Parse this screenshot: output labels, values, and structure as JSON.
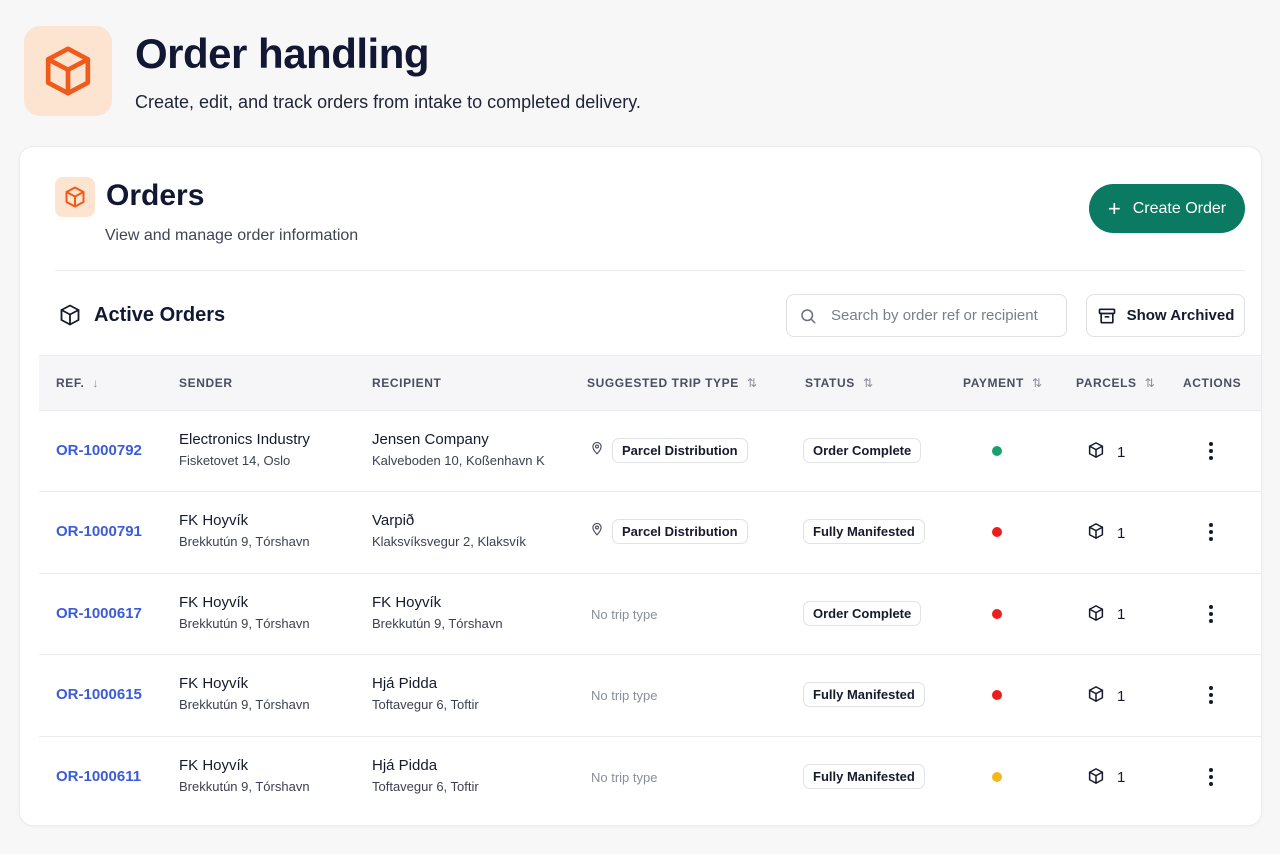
{
  "page": {
    "title": "Order handling",
    "subtitle": "Create, edit, and track orders from intake to completed delivery.",
    "icon": "box-icon",
    "accent": "#f05a1a"
  },
  "orders_card": {
    "title": "Orders",
    "subtitle": "View and manage order information",
    "create_label": "Create Order",
    "create_color": "#0a7a62"
  },
  "active": {
    "title": "Active Orders",
    "search_placeholder": "Search by order ref or recipient",
    "archived_label": "Show Archived"
  },
  "columns": [
    {
      "label": "REF.",
      "sort": "↓"
    },
    {
      "label": "SENDER",
      "sort": ""
    },
    {
      "label": "RECIPIENT",
      "sort": ""
    },
    {
      "label": "SUGGESTED TRIP TYPE",
      "sort": "⇅"
    },
    {
      "label": "STATUS",
      "sort": "⇅"
    },
    {
      "label": "PAYMENT",
      "sort": "⇅"
    },
    {
      "label": "PARCELS",
      "sort": "⇅"
    },
    {
      "label": "ACTIONS",
      "sort": ""
    }
  ],
  "payment_colors": {
    "paid": "#1aa06d",
    "unpaid": "#ee1c1c",
    "pending": "#f4b81c"
  },
  "orders": [
    {
      "ref": "OR-1000792",
      "sender_name": "Electronics Industry",
      "sender_addr": "Fisketovet 14, Oslo",
      "recipient_name": "Jensen Company",
      "recipient_addr": "Kalveboden 10, Koßenhavn K",
      "trip": "Parcel Distribution",
      "status": "Order Complete",
      "payment": "paid",
      "parcels": "1"
    },
    {
      "ref": "OR-1000791",
      "sender_name": "FK Hoyvík",
      "sender_addr": "Brekkutún 9, Tórshavn",
      "recipient_name": "Varpið",
      "recipient_addr": "Klaksvíksvegur 2, Klaksvík",
      "trip": "Parcel Distribution",
      "status": "Fully Manifested",
      "payment": "unpaid",
      "parcels": "1"
    },
    {
      "ref": "OR-1000617",
      "sender_name": "FK Hoyvík",
      "sender_addr": "Brekkutún 9, Tórshavn",
      "recipient_name": "FK Hoyvík",
      "recipient_addr": "Brekkutún 9, Tórshavn",
      "trip": "",
      "status": "Order Complete",
      "payment": "unpaid",
      "parcels": "1"
    },
    {
      "ref": "OR-1000615",
      "sender_name": "FK Hoyvík",
      "sender_addr": "Brekkutún 9, Tórshavn",
      "recipient_name": "Hjá Pidda",
      "recipient_addr": "Toftavegur 6, Toftir",
      "trip": "",
      "status": "Fully Manifested",
      "payment": "unpaid",
      "parcels": "1"
    },
    {
      "ref": "OR-1000611",
      "sender_name": "FK Hoyvík",
      "sender_addr": "Brekkutún 9, Tórshavn",
      "recipient_name": "Hjá Pidda",
      "recipient_addr": "Toftavegur 6, Toftir",
      "trip": "",
      "status": "Fully Manifested",
      "payment": "pending",
      "parcels": "1"
    }
  ],
  "no_trip_label": "No trip type"
}
